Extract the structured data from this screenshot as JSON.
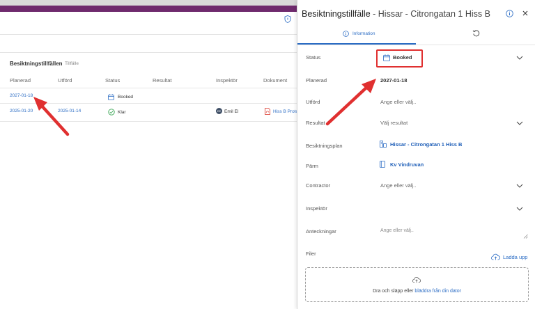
{
  "list": {
    "section_title": "Besiktningstillfällen",
    "section_tab": "Tillfälle",
    "columns": [
      "Planerad",
      "Utförd",
      "Status",
      "Resultat",
      "Inspektör",
      "Dokument"
    ],
    "rows": [
      {
        "planerad": "2027-01-18",
        "utford": "",
        "status": "Booked",
        "resultat": "",
        "inspektor": "",
        "dokument": ""
      },
      {
        "planerad": "2025-01-20",
        "utford": "2025-01-14",
        "status": "Klar",
        "resultat": "",
        "inspektor_initials": "EE",
        "inspektor": "Emil El",
        "dokument": "Hiss B Protol"
      }
    ]
  },
  "panel": {
    "title_main": "Besiktningstillfälle",
    "title_sub": " - Hissar - Citrongatan 1 Hiss B",
    "tab_info": "Information",
    "fields": {
      "status_label": "Status",
      "status_value": "Booked",
      "planerad_label": "Planerad",
      "planerad_value": "2027-01-18",
      "utford_label": "Utförd",
      "utford_placeholder": "Ange eller välj..",
      "resultat_label": "Resultat",
      "resultat_placeholder": "Välj resultat",
      "plan_label": "Besiktningsplan",
      "plan_value": "Hissar - Citrongatan 1 Hiss B",
      "parm_label": "Pärm",
      "parm_value": "Kv Vindruvan",
      "contractor_label": "Contractor",
      "contractor_placeholder": "Ange eller välj..",
      "inspektor_label": "Inspektör",
      "anteckningar_label": "Anteckningar",
      "anteckningar_placeholder": "Ange eller välj..",
      "filer_label": "Filer"
    },
    "upload_label": "Ladda upp",
    "dropzone_text": "Dra och släpp eller ",
    "dropzone_link": "bläddra från din dator"
  },
  "colors": {
    "brand_purple": "#6f2a6d",
    "link_blue": "#2b6cc4",
    "annotation_red": "#e03030"
  }
}
